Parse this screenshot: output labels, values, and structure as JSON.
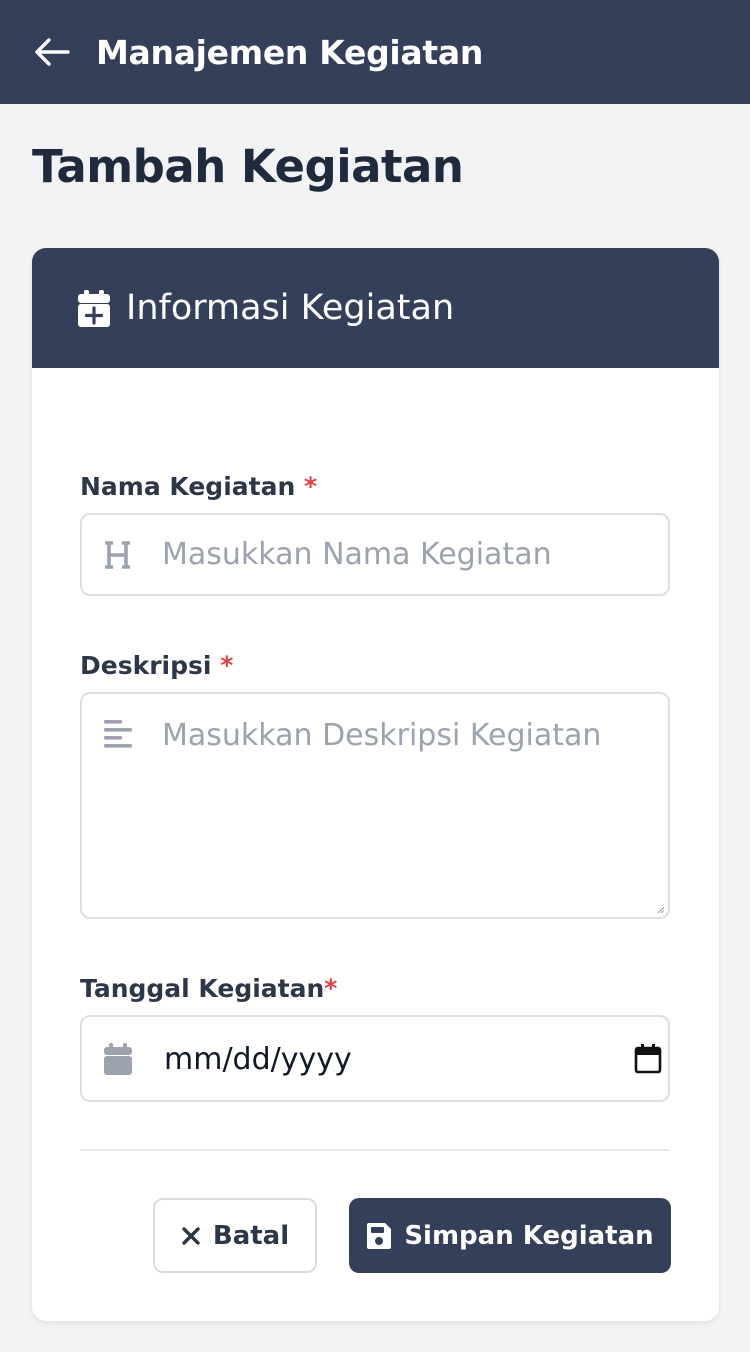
{
  "topbar": {
    "back_icon": "arrow-left-icon",
    "title": "Manajemen Kegiatan"
  },
  "page": {
    "title": "Tambah Kegiatan"
  },
  "card": {
    "header_icon": "calendar-plus-icon",
    "header_title": "Informasi Kegiatan"
  },
  "form": {
    "name": {
      "label": "Nama Kegiatan",
      "required_mark": "*",
      "icon": "heading-icon",
      "placeholder": "Masukkan Nama Kegiatan",
      "value": ""
    },
    "description": {
      "label": "Deskripsi",
      "required_mark": "*",
      "icon": "align-left-icon",
      "placeholder": "Masukkan Deskripsi Kegiatan",
      "value": ""
    },
    "date": {
      "label": "Tanggal Kegiatan",
      "required_mark": "*",
      "icon": "calendar-icon",
      "value_text": "mm/dd/yyyy",
      "picker_icon": "calendar-picker-icon"
    }
  },
  "actions": {
    "cancel_icon": "close-icon",
    "cancel_label": "Batal",
    "save_icon": "save-icon",
    "save_label": "Simpan Kegiatan"
  },
  "colors": {
    "primary": "#344059",
    "background": "#f2f3f5",
    "required": "#e53e3e",
    "placeholder": "#9ca3af"
  }
}
